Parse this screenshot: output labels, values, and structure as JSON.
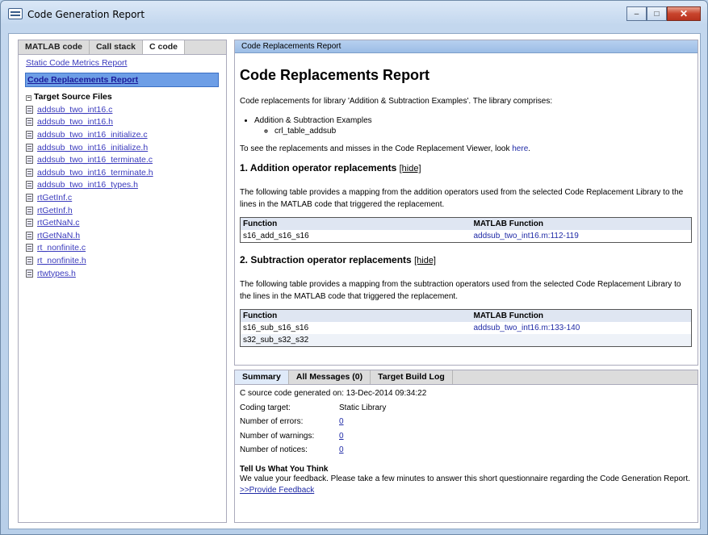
{
  "window": {
    "title": "Code Generation Report",
    "minimize": "–",
    "maximize": "□",
    "close": "✕"
  },
  "nav": {
    "tabs": [
      "MATLAB code",
      "Call stack",
      "C code"
    ],
    "links": [
      "Static Code Metrics Report",
      "Code Replacements Report"
    ],
    "section": "Target Source Files",
    "files": [
      "addsub_two_int16.c",
      "addsub_two_int16.h",
      "addsub_two_int16_initialize.c",
      "addsub_two_int16_initialize.h",
      "addsub_two_int16_terminate.c",
      "addsub_two_int16_terminate.h",
      "addsub_two_int16_types.h",
      "rtGetInf.c",
      "rtGetInf.h",
      "rtGetNaN.c",
      "rtGetNaN.h",
      "rt_nonfinite.c",
      "rt_nonfinite.h",
      "rtwtypes.h"
    ]
  },
  "main": {
    "header": "Code Replacements Report",
    "title": "Code Replacements Report",
    "intro": "Code replacements for library 'Addition & Subtraction Examples'. The library comprises:",
    "lib_item": "Addition & Subtraction Examples",
    "lib_sub": "crl_table_addsub",
    "viewer_text": "To see the replacements and misses in the Code Replacement Viewer, look",
    "viewer_link": "here",
    "viewer_end": ".",
    "hide": "[hide]",
    "add": {
      "heading": "1. Addition operator replacements",
      "desc": "The following table provides a mapping from the addition operators used from the selected Code Replacement Library to the lines in the MATLAB code that triggered the replacement.",
      "cols": [
        "Function",
        "MATLAB Function"
      ],
      "rows": [
        [
          "s16_add_s16_s16",
          "addsub_two_int16.m:112-119"
        ]
      ]
    },
    "sub": {
      "heading": "2. Subtraction operator replacements",
      "desc": "The following table provides a mapping from the subtraction operators used from the selected Code Replacement Library to the lines in the MATLAB code that triggered the replacement.",
      "cols": [
        "Function",
        "MATLAB Function"
      ],
      "rows": [
        [
          "s16_sub_s16_s16",
          "addsub_two_int16.m:133-140"
        ],
        [
          "s32_sub_s32_s32",
          ""
        ]
      ]
    }
  },
  "summary": {
    "tabs": [
      "Summary",
      "All Messages (0)",
      "Target Build Log"
    ],
    "generated_label": "C source code generated on:",
    "generated_value": "13-Dec-2014 09:34:22",
    "target_label": "Coding target:",
    "target_value": "Static Library",
    "errors_label": "Number of errors:",
    "errors_value": "0",
    "warnings_label": "Number of warnings:",
    "warnings_value": "0",
    "notices_label": "Number of notices:",
    "notices_value": "0",
    "fb_title": "Tell Us What You Think",
    "fb_text": "We value your feedback. Please take a few minutes to answer this short questionnaire regarding the Code Generation Report.",
    "fb_link": ">>Provide Feedback"
  }
}
